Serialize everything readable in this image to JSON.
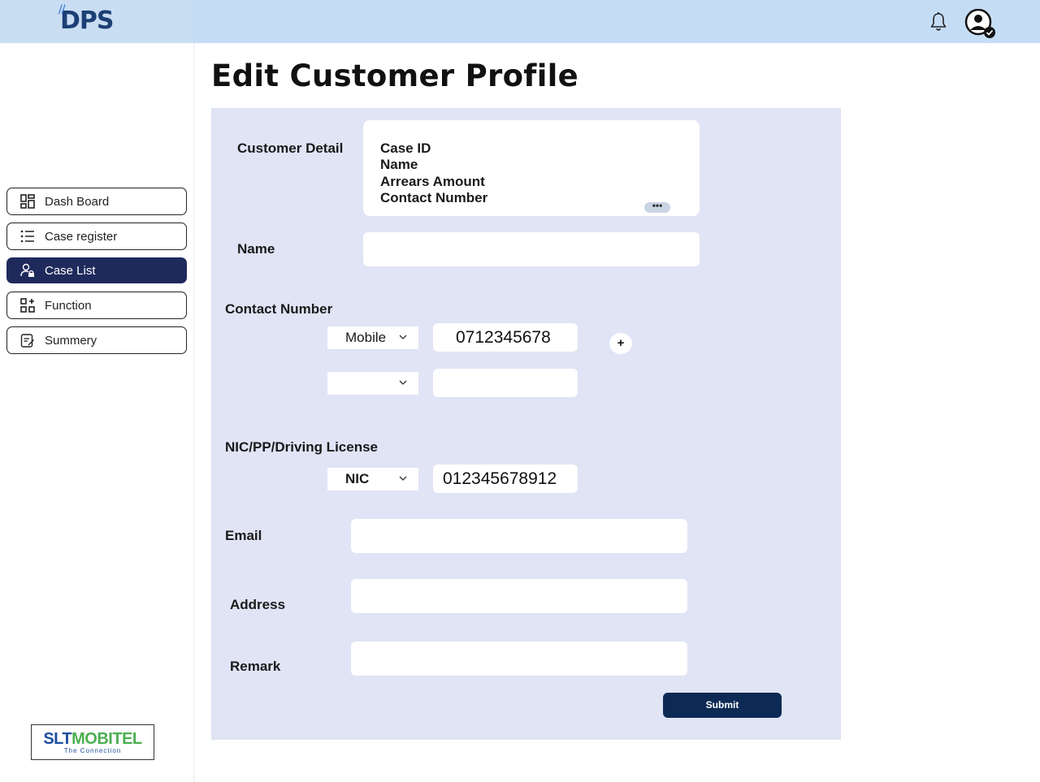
{
  "header": {
    "logo_text": "DPS",
    "icons": [
      "bell-icon",
      "user-check-icon"
    ]
  },
  "sidebar": {
    "items": [
      {
        "label": "Dash Board",
        "icon": "dashboard-icon",
        "active": false
      },
      {
        "label": "Case register",
        "icon": "list-icon",
        "active": false
      },
      {
        "label": "Case List",
        "icon": "user-lock-icon",
        "active": true
      },
      {
        "label": "Function",
        "icon": "add-grid-icon",
        "active": false
      },
      {
        "label": "Summery",
        "icon": "edit-note-icon",
        "active": false
      }
    ],
    "footer_logo": {
      "brand_a": "SLT",
      "brand_b": "MOBITEL",
      "tagline": "The Connection"
    }
  },
  "page": {
    "title": "Edit Customer Profile"
  },
  "form": {
    "customer_detail": {
      "label": "Customer Detail",
      "lines": [
        "Case ID",
        "Name",
        "Arrears Amount",
        "Contact Number"
      ],
      "more": "•••"
    },
    "name": {
      "label": "Name",
      "value": ""
    },
    "contact": {
      "label": "Contact Number",
      "rows": [
        {
          "type": "Mobile",
          "number": "0712345678"
        },
        {
          "type": "",
          "number": ""
        }
      ],
      "add": "+"
    },
    "id_doc": {
      "label": "NIC/PP/Driving License",
      "type": "NIC",
      "number": "012345678912"
    },
    "email": {
      "label": "Email",
      "value": ""
    },
    "address": {
      "label": "Address",
      "value": ""
    },
    "remark": {
      "label": "Remark",
      "value": ""
    },
    "submit_label": "Submit"
  },
  "colors": {
    "topbar": "#c5dcf5",
    "panel": "#e0e4f5",
    "active_nav": "#1f2a5c",
    "submit": "#0c2a55"
  }
}
